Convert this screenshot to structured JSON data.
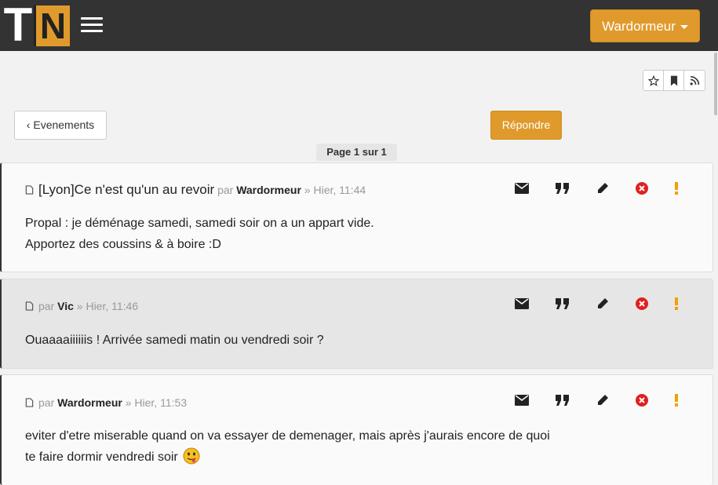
{
  "navbar": {
    "logo_t": "T",
    "logo_n": "N",
    "user_label": "Wardormeur",
    "colors": {
      "bar": "#333333",
      "accent": "#e09a2c"
    }
  },
  "topic_tools": {
    "icons": [
      "star-icon",
      "bookmark-icon",
      "rss-icon"
    ]
  },
  "toolbar": {
    "back_label": "Evenements",
    "reply_label": "Répondre",
    "pagination": "Page 1 sur 1"
  },
  "posts": [
    {
      "title": "[Lyon]Ce n'est qu'un au revoir",
      "by": "par",
      "author": "Wardormeur",
      "time": "» Hier, 11:44",
      "lines": [
        "Propal : je déménage samedi, samedi soir on a un appart vide.",
        "Apportez des coussins & à boire :D"
      ]
    },
    {
      "title": "",
      "by": "par",
      "author": "Vic",
      "time": "» Hier, 11:46",
      "lines": [
        "Ouaaaaiiiiiis ! Arrivée samedi matin ou vendredi soir ?"
      ]
    },
    {
      "title": "",
      "by": "par",
      "author": "Wardormeur",
      "time": "» Hier, 11:53",
      "lines": [
        "eviter d'etre miserable quand on va essayer de demenager, mais après j'aurais encore de quoi",
        "te faire dormir vendredi soir"
      ]
    }
  ],
  "post_actions": [
    "envelope-icon",
    "quote-icon",
    "pencil-icon",
    "delete-icon",
    "report-icon"
  ],
  "colors": {
    "delete": "#e02020",
    "report": "#f0a000"
  }
}
